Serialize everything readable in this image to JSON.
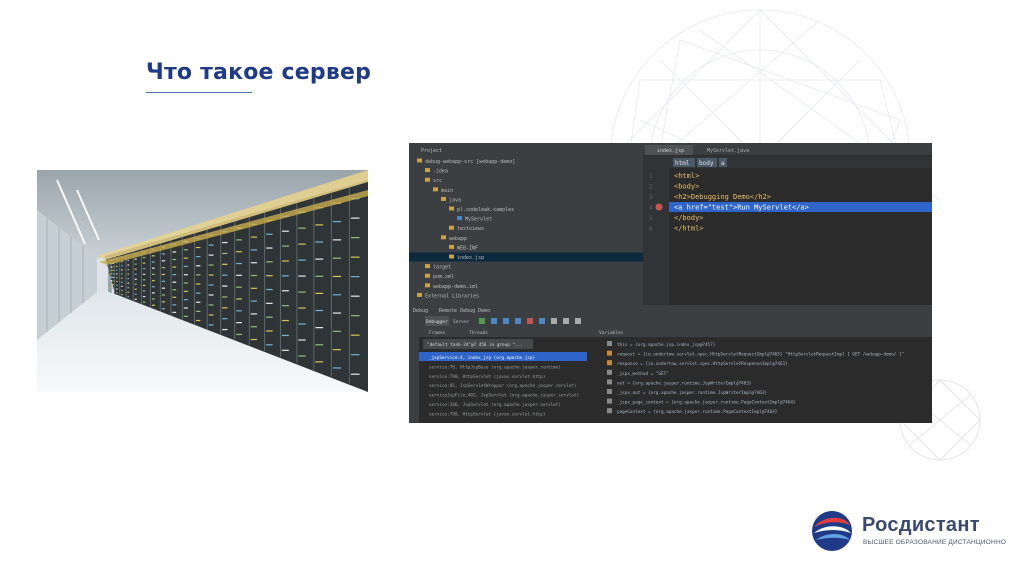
{
  "slide": {
    "title": "Что такое сервер"
  },
  "photo": {
    "subject": "data center server racks"
  },
  "ide": {
    "project_label": "Project",
    "tabs": [
      "index.jsp",
      "MyServlet.java"
    ],
    "breadcrumb": [
      "html",
      "body",
      "a"
    ],
    "tree": [
      "debug-webapp-src [webapp-demo]",
      ".idea",
      "src",
      "main",
      "java",
      "pl.codeleak.samples",
      "MyServlet",
      "textviews",
      "webapp",
      "WEB-INF",
      "index.jsp",
      "target",
      "pom.xml",
      "webapp-demo.iml",
      "External Libraries"
    ],
    "code_lines": [
      "<html>",
      "<body>",
      "<h2>Debugging Demo</h2>",
      "<a href=\"test\">Run MyServlet</a>",
      "</body>",
      "</html>"
    ],
    "line_numbers": [
      "1",
      "2",
      "3",
      "4",
      "5",
      "6"
    ],
    "debug_title": "Debug",
    "debug_config": "Remote Debug Demo",
    "debug_tabs": [
      "Debugger",
      "Server"
    ],
    "frames_label": "Frames",
    "threads_label": "Threads",
    "thread_selector": "\"default task-24\"@7 456 in group \"...",
    "frames": [
      "_jspService:4, index_jsp (org.apache.jsp)",
      "service:70, HttpJspBase (org.apache.jasper.runtime)",
      "service:790, HttpServlet (javax.servlet.http)",
      "service:85, JspServletWrapper (org.apache.jasper.servlet)",
      "serviceJspFile:402, JspServlet (org.apache.jasper.servlet)",
      "service:346, JspServlet (org.apache.jasper.servlet)",
      "service:790, HttpServlet (javax.servlet.http)"
    ],
    "variables_label": "Variables",
    "variables": [
      "this = {org.apache.jsp.index_jsp@7457}",
      "request = {io.undertow.servlet.spec.HttpServletRequestImpl@7465} \"HttpServletRequestImpl [ GET /webapp-demo/ ]\"",
      "response = {io.undertow.servlet.spec.HttpServletResponseImpl@7461}",
      "_jspx_method = \"GET\"",
      "out = {org.apache.jasper.runtime.JspWriterImpl@7463}",
      "_jspx_out = {org.apache.jasper.runtime.JspWriterImpl@7463}",
      "_jspx_page_context = {org.apache.jasper.runtime.PageContextImpl@7464}",
      "pageContext = {org.apache.jasper.runtime.PageContextImpl@7464}"
    ]
  },
  "logo": {
    "name": "Росдистант",
    "tagline": "ВЫСШЕЕ ОБРАЗОВАНИЕ ДИСТАНЦИОННО"
  },
  "colors": {
    "title": "#1f3a86",
    "logo_text": "#3a4a6e",
    "ide_bg": "#2b2b2b",
    "ide_selection": "#2f65ca"
  }
}
